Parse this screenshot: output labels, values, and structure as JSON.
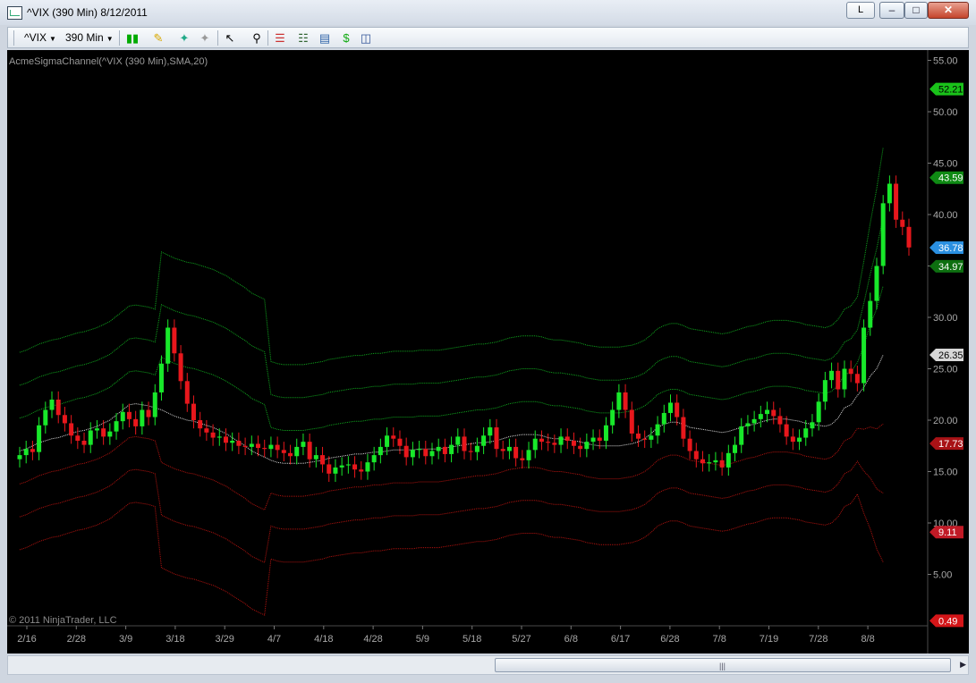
{
  "window": {
    "title": "^VIX (390 Min)  8/12/2011",
    "link_button": "L",
    "min": "–",
    "max": "□",
    "close": "✕"
  },
  "toolbar": {
    "instrument": "^VIX",
    "interval": "390 Min"
  },
  "indicator_label": "AcmeSigmaChannel(^VIX (390 Min),SMA,20)",
  "copyright": "© 2011 NinjaTrader, LLC",
  "colors": {
    "up": "#18e82a",
    "down": "#e8171c",
    "sma": "#d9d9d9",
    "upper": "#0fa51d",
    "lower": "#b3130f",
    "background": "#000000"
  },
  "chart_data": {
    "type": "candlestick",
    "y_ticks": [
      "55.00",
      "50.00",
      "45.00",
      "40.00",
      "35.00",
      "30.00",
      "25.00",
      "20.00",
      "15.00",
      "10.00",
      "5.00"
    ],
    "ylim": [
      0,
      56
    ],
    "x_ticks": [
      "2/16",
      "2/28",
      "3/9",
      "3/18",
      "3/29",
      "4/7",
      "4/18",
      "4/28",
      "5/9",
      "5/18",
      "5/27",
      "6/8",
      "6/17",
      "6/28",
      "7/8",
      "7/19",
      "7/28",
      "8/8"
    ],
    "price_markers": [
      {
        "label": "52.21",
        "value": 52.21,
        "color": "#1ac21a",
        "text": "#000"
      },
      {
        "label": "43.59",
        "value": 43.59,
        "color": "#0f8a14",
        "text": "#fff"
      },
      {
        "label": "36.78",
        "value": 36.78,
        "color": "#2a8fe0",
        "text": "#fff"
      },
      {
        "label": "34.97",
        "value": 34.97,
        "color": "#0d6f10",
        "text": "#fff"
      },
      {
        "label": "26.35",
        "value": 26.35,
        "color": "#d8d8d8",
        "text": "#000"
      },
      {
        "label": "17.73",
        "value": 17.73,
        "color": "#a81216",
        "text": "#fff"
      },
      {
        "label": "9.11",
        "value": 9.11,
        "color": "#c11a26",
        "text": "#fff"
      },
      {
        "label": "0.49",
        "value": 0.49,
        "color": "#d41518",
        "text": "#fff"
      }
    ],
    "closes": [
      16.6,
      17.2,
      16.9,
      19.5,
      21.0,
      22.0,
      20.5,
      19.7,
      18.5,
      18.0,
      17.6,
      19.0,
      19.2,
      18.4,
      18.9,
      19.9,
      20.8,
      20.1,
      19.4,
      21.0,
      20.3,
      22.7,
      25.5,
      29.0,
      26.5,
      23.8,
      21.6,
      20.0,
      19.2,
      18.8,
      18.3,
      18.4,
      17.8,
      18.0,
      17.5,
      17.4,
      17.7,
      17.3,
      17.2,
      17.6,
      17.1,
      16.8,
      16.5,
      17.4,
      17.9,
      16.2,
      16.6,
      15.7,
      14.8,
      15.4,
      15.6,
      15.7,
      15.2,
      15.0,
      15.9,
      16.6,
      17.4,
      18.5,
      18.2,
      17.5,
      16.4,
      17.1,
      17.2,
      16.5,
      17.0,
      17.4,
      16.7,
      17.6,
      18.4,
      17.0,
      16.9,
      17.5,
      18.5,
      19.3,
      17.2,
      17.0,
      17.4,
      16.3,
      16.1,
      17.1,
      18.2,
      17.9,
      17.8,
      17.6,
      18.4,
      18.0,
      17.5,
      17.2,
      17.9,
      18.3,
      18.0,
      19.5,
      21.0,
      22.7,
      21.0,
      18.7,
      18.2,
      18.1,
      18.5,
      19.6,
      20.7,
      21.7,
      20.3,
      18.2,
      17.0,
      16.2,
      15.8,
      15.9,
      16.1,
      15.4,
      16.8,
      17.6,
      19.4,
      19.7,
      20.1,
      20.6,
      21.0,
      20.4,
      19.6,
      18.4,
      17.9,
      18.3,
      19.2,
      19.8,
      21.8,
      23.9,
      24.8,
      23.0,
      25.0,
      24.5,
      23.6,
      29.0,
      31.6,
      35.0,
      41.1,
      43.0,
      39.5,
      38.8,
      36.8
    ],
    "sma": [
      17,
      17.2,
      17.5,
      17.8,
      18,
      18.2,
      18.3,
      18.5,
      18.7,
      18.9,
      19,
      19.2,
      19.4,
      19.7,
      20,
      20.5,
      21,
      21.5,
      21.6,
      21.5,
      21.4,
      21.2,
      21,
      20.7,
      20.4,
      20.2,
      20,
      19.9,
      19.7,
      19.5,
      19.3,
      19,
      18.7,
      18.3,
      17.9,
      17.5,
      17,
      16.7,
      16.4,
      16.1,
      15.9,
      15.8,
      15.8,
      15.8,
      15.8,
      15.9,
      16,
      16.1,
      16.3,
      16.4,
      16.5,
      16.6,
      16.7,
      16.7,
      16.8,
      16.9,
      16.9,
      17,
      17.1,
      17.1,
      17.1,
      17.1,
      17.2,
      17.2,
      17.2,
      17.2,
      17.3,
      17.4,
      17.5,
      17.6,
      17.7,
      17.8,
      17.8,
      17.9,
      18,
      18.2,
      18.4,
      18.5,
      18.6,
      18.6,
      18.6,
      18.5,
      18.3,
      18.2,
      18.2,
      18.1,
      18,
      17.9,
      17.7,
      17.6,
      17.5,
      17.5,
      17.5,
      17.5,
      17.6,
      17.7,
      17.9,
      18.2,
      18.7,
      19.3,
      19.6,
      19.8,
      19.8,
      19.6,
      19.3,
      19.2,
      19.1,
      19,
      18.9,
      18.8,
      18.9,
      19.1,
      19.3,
      19.5,
      19.6,
      19.8,
      20,
      20.1,
      20.1,
      20.1,
      20,
      19.9,
      19.7,
      19.6,
      19.5,
      19.4,
      19.6,
      20.2,
      21.2,
      21.5,
      22.4,
      23.2,
      24.3,
      25,
      26.35
    ],
    "upper_offsets": [
      3.2,
      6.4,
      9.6,
      34.79
    ],
    "lower_offsets": [
      3.2,
      6.4,
      9.6,
      25.86
    ]
  }
}
